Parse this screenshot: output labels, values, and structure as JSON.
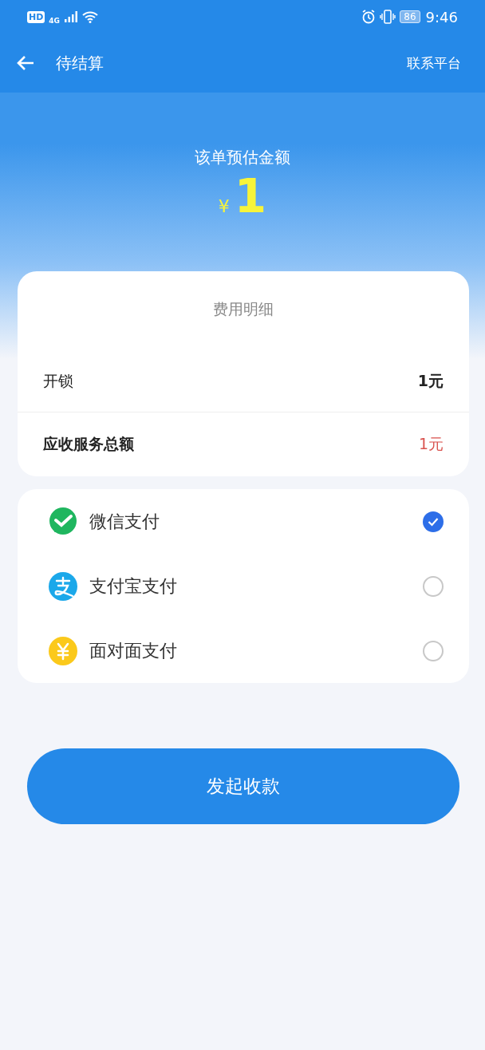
{
  "status_bar": {
    "hd": "HD",
    "network": "4G",
    "battery": "86",
    "time": "9:46"
  },
  "header": {
    "title": "待结算",
    "action": "联系平台"
  },
  "estimate": {
    "label": "该单预估金额",
    "currency": "¥",
    "amount": "1"
  },
  "fee_card": {
    "title": "费用明细",
    "rows": [
      {
        "label": "开锁",
        "value": "1元",
        "kind": "item"
      },
      {
        "label": "应收服务总额",
        "value": "1元",
        "kind": "total"
      }
    ]
  },
  "payment_methods": [
    {
      "label": "微信支付",
      "kind": "wechat",
      "selected": true
    },
    {
      "label": "支付宝支付",
      "kind": "alipay",
      "selected": false
    },
    {
      "label": "面对面支付",
      "kind": "cash",
      "selected": false
    }
  ],
  "submit_button": "发起收款"
}
